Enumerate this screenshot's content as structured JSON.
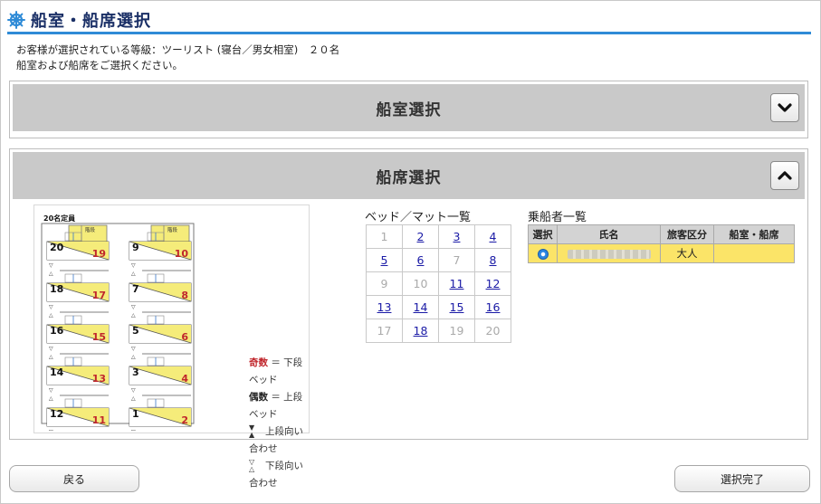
{
  "header": {
    "title": "船室・船席選択"
  },
  "info": {
    "line1": "お客様が選択されている等級：ツーリスト (寝台／男女相室)　２０名",
    "line2": "船室および船席をご選択ください。"
  },
  "cabin_panel": {
    "title": "船室選択",
    "toggle_icon": "chevron-down-icon"
  },
  "seat_panel": {
    "title": "船席選択",
    "toggle_icon": "chevron-up-icon"
  },
  "seat_map": {
    "capacity_label": "20名定員",
    "stairs_label": "階段",
    "left_column": [
      {
        "upper": "20",
        "lower": "19"
      },
      {
        "upper": "18",
        "lower": "17"
      },
      {
        "upper": "16",
        "lower": "15"
      },
      {
        "upper": "14",
        "lower": "13"
      },
      {
        "upper": "12",
        "lower": "11"
      }
    ],
    "right_column": [
      {
        "upper": "9",
        "lower": "10"
      },
      {
        "upper": "7",
        "lower": "8"
      },
      {
        "upper": "5",
        "lower": "6"
      },
      {
        "upper": "3",
        "lower": "4"
      },
      {
        "upper": "1",
        "lower": "2"
      }
    ],
    "legend": {
      "odd_word": "奇数",
      "odd_text": " ＝ 下段ベッド",
      "even_word": "偶数",
      "even_text": " ＝ 上段ベッド",
      "upper_facing": "上段向い合わせ",
      "lower_facing": "下段向い合わせ"
    },
    "colors": {
      "upper_bed": "#f5ec7a",
      "number_red": "#c0262c"
    }
  },
  "beds": {
    "title": "ベッド／マット一覧",
    "rows": [
      [
        {
          "n": "1",
          "link": false
        },
        {
          "n": "2",
          "link": true
        },
        {
          "n": "3",
          "link": true
        },
        {
          "n": "4",
          "link": true
        }
      ],
      [
        {
          "n": "5",
          "link": true
        },
        {
          "n": "6",
          "link": true
        },
        {
          "n": "7",
          "link": false
        },
        {
          "n": "8",
          "link": true
        }
      ],
      [
        {
          "n": "9",
          "link": false
        },
        {
          "n": "10",
          "link": false
        },
        {
          "n": "11",
          "link": true
        },
        {
          "n": "12",
          "link": true
        }
      ],
      [
        {
          "n": "13",
          "link": true
        },
        {
          "n": "14",
          "link": true
        },
        {
          "n": "15",
          "link": true
        },
        {
          "n": "16",
          "link": true
        }
      ],
      [
        {
          "n": "17",
          "link": false
        },
        {
          "n": "18",
          "link": true
        },
        {
          "n": "19",
          "link": false
        },
        {
          "n": "20",
          "link": false
        }
      ]
    ]
  },
  "passengers": {
    "title": "乗船者一覧",
    "headers": [
      "選択",
      "氏名",
      "旅客区分",
      "船室・船席"
    ],
    "rows": [
      {
        "name": "",
        "category": "大人",
        "seat": "",
        "selected": true
      }
    ],
    "colors": {
      "selected_row": "#fbe468",
      "header": "#d3d3d3"
    }
  },
  "footer": {
    "back_label": "戻る",
    "done_label": "選択完了"
  },
  "colors": {
    "accent": "#2f8bd7",
    "title_text": "#1a2f66",
    "panel_header": "#c9c9c9"
  }
}
